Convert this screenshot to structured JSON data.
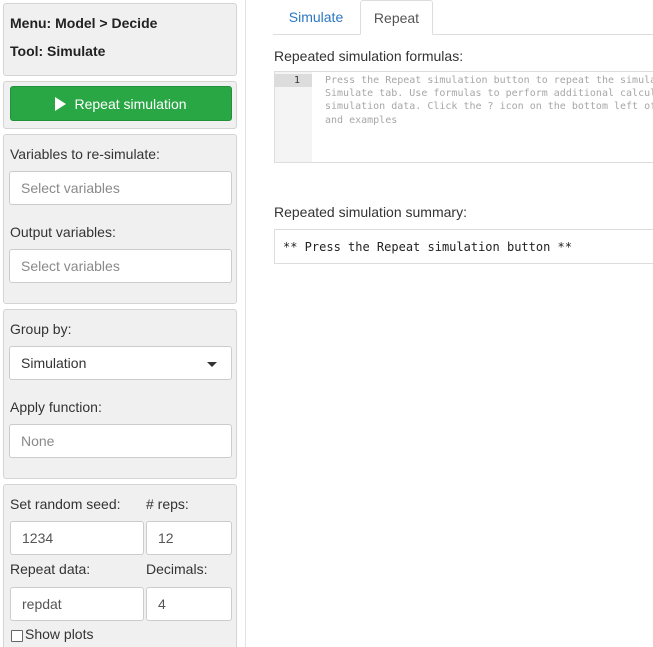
{
  "sidebar": {
    "menu_label": "Menu: Model > Decide",
    "tool_label": "Tool: Simulate",
    "run_button_label": "Repeat simulation",
    "vars_label": "Variables to re-simulate:",
    "vars_placeholder": "Select variables",
    "output_label": "Output variables:",
    "output_placeholder": "Select variables",
    "group_by_label": "Group by:",
    "group_by_value": "Simulation",
    "apply_fun_label": "Apply function:",
    "apply_fun_placeholder": "None",
    "seed_label": "Set random seed:",
    "seed_value": "1234",
    "reps_label": "# reps:",
    "reps_value": "12",
    "repeat_data_label": "Repeat data:",
    "repeat_data_value": "repdat",
    "decimals_label": "Decimals:",
    "decimals_value": "4",
    "show_plots_label": "Show plots"
  },
  "tabs": [
    {
      "label": "Simulate",
      "active": false
    },
    {
      "label": "Repeat",
      "active": true
    }
  ],
  "main": {
    "formulas_heading": "Repeated simulation formulas:",
    "editor_line_number": "1",
    "editor_lines": [
      "Press the Repeat simulation button to repeat the simulat",
      "Simulate tab. Use formulas to perform additional calcula",
      "simulation data. Click the ? icon on the bottom left of",
      "and examples"
    ],
    "summary_heading": "Repeated simulation summary:",
    "summary_text": "** Press the Repeat simulation button **"
  },
  "colors": {
    "run_button": "#29a745",
    "tab_link": "#2a78c2",
    "well_bg": "#f0f0f0"
  }
}
